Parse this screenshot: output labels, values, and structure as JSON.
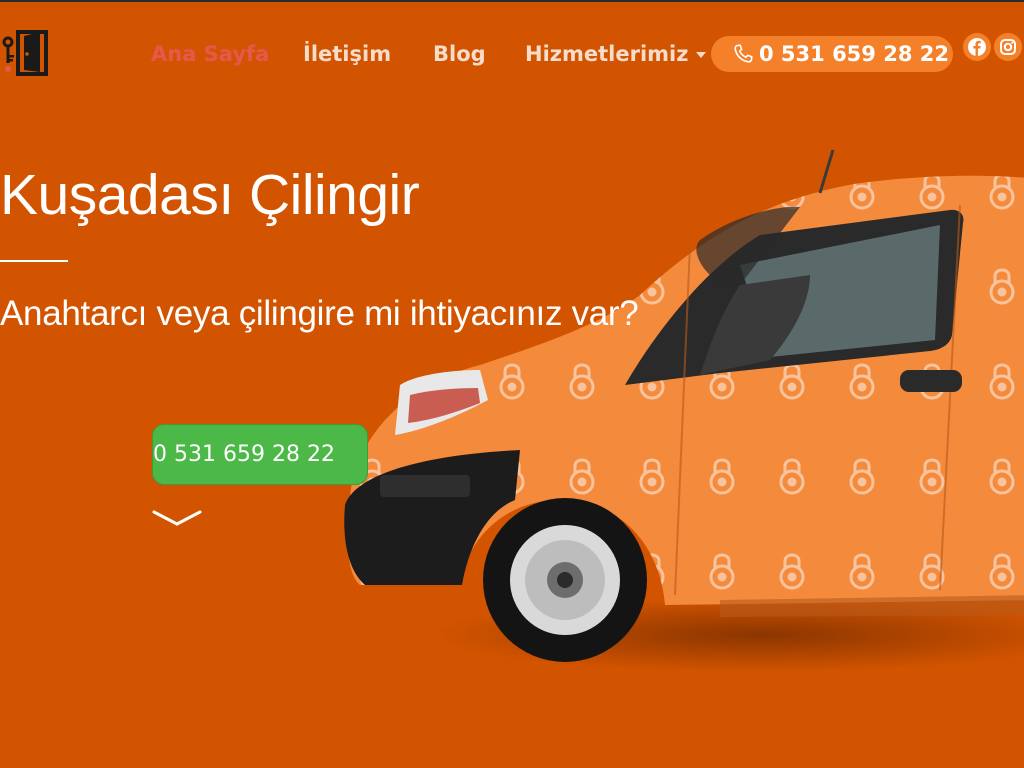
{
  "header": {
    "logo_icon": "door-key-icon",
    "nav": [
      {
        "label": "Ana Sayfa",
        "active": true
      },
      {
        "label": "İletişim"
      },
      {
        "label": "Blog"
      },
      {
        "label": "Hizmetlerimiz",
        "has_dropdown": true
      }
    ],
    "phone": "0 531 659 28 22",
    "phone_icon": "phone-icon",
    "social": [
      {
        "icon": "facebook-icon"
      },
      {
        "icon": "instagram-icon"
      }
    ]
  },
  "hero": {
    "title": "Kuşadası Çilingir",
    "subtitle": "Anahtarcı veya çilingire mi ihtiyacınız var?",
    "cta_phone": "0 531 659 28 22",
    "scroll_icon": "chevron-down-icon",
    "image": "orange-van-with-padlock-pattern"
  },
  "colors": {
    "background": "#d35400",
    "accent": "#f5802a",
    "active_nav": "#e8574e",
    "cta_green": "#4cb848"
  }
}
